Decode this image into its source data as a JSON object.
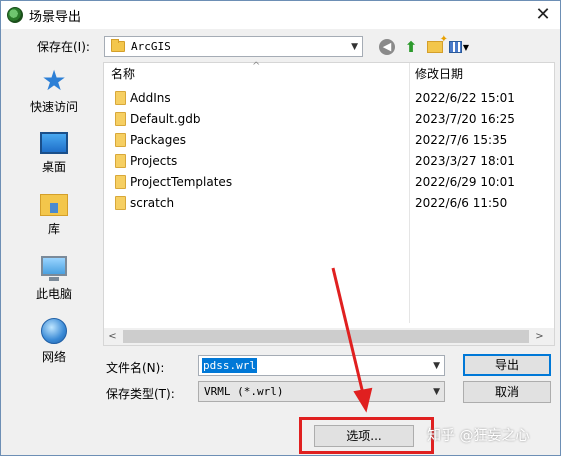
{
  "window": {
    "title": "场景导出",
    "close_glyph": "✕"
  },
  "save_in": {
    "label": "保存在(I):",
    "value": "ArcGIS"
  },
  "file_list": {
    "columns": {
      "name": "名称",
      "date": "修改日期"
    },
    "rows": [
      {
        "name": "AddIns",
        "date": "2022/6/22 15:01"
      },
      {
        "name": "Default.gdb",
        "date": "2023/7/20 16:25"
      },
      {
        "name": "Packages",
        "date": "2022/7/6 15:35"
      },
      {
        "name": "Projects",
        "date": "2023/3/27 18:01"
      },
      {
        "name": "ProjectTemplates",
        "date": "2022/6/29 10:01"
      },
      {
        "name": "scratch",
        "date": "2022/6/6 11:50"
      }
    ]
  },
  "places": [
    {
      "label": "快速访问",
      "icon": "star-icon"
    },
    {
      "label": "桌面",
      "icon": "desktop-icon"
    },
    {
      "label": "库",
      "icon": "library-icon"
    },
    {
      "label": "此电脑",
      "icon": "computer-icon"
    },
    {
      "label": "网络",
      "icon": "network-icon"
    }
  ],
  "file_name": {
    "label": "文件名(N):",
    "value": "pdss.wrl"
  },
  "file_type": {
    "label": "保存类型(T):",
    "value": "VRML (*.wrl)"
  },
  "buttons": {
    "export": "导出",
    "cancel": "取消",
    "options": "选项..."
  },
  "watermark": "知乎 @狂妄之心",
  "colors": {
    "highlight": "#e02020",
    "selection": "#0078d7",
    "folder": "#f6cf62"
  }
}
